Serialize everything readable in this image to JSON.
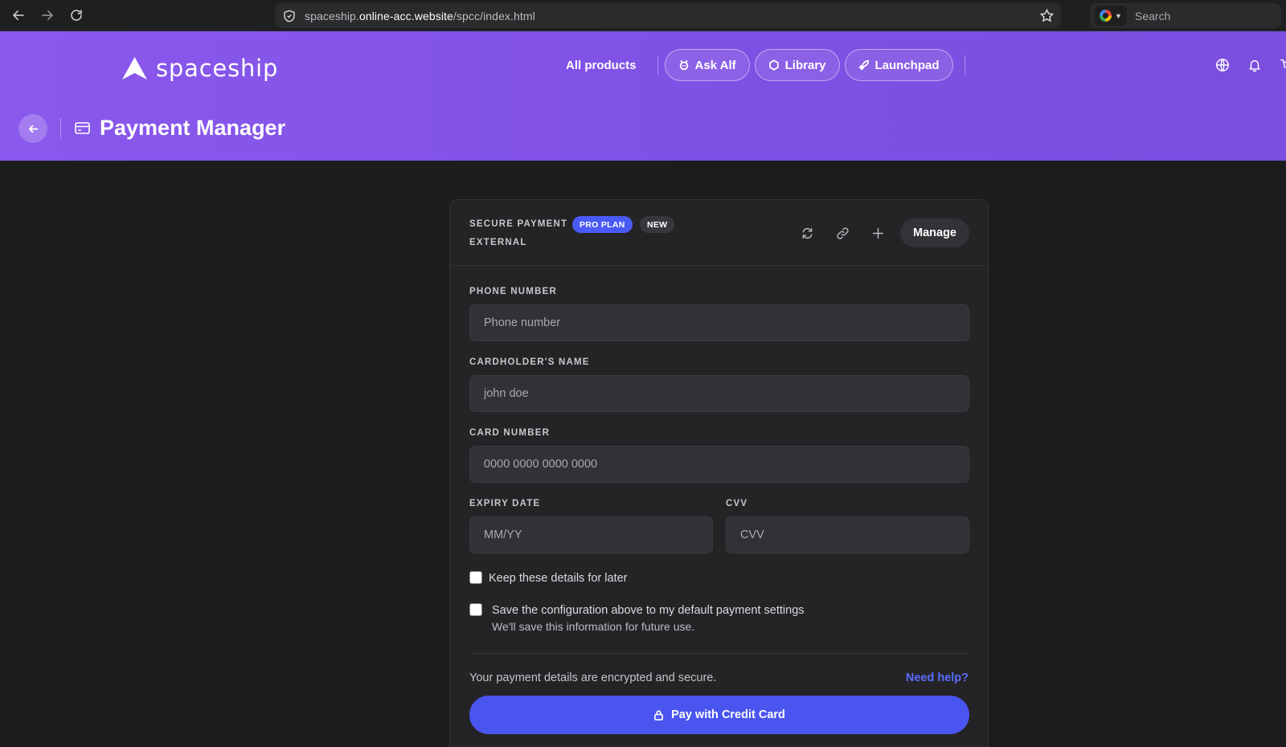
{
  "browser": {
    "url_prefix": "spaceship.",
    "url_domain": "online-acc.website",
    "url_path": "/spcc/index.html",
    "search_placeholder": "Search"
  },
  "header": {
    "brand": "spaceship",
    "nav": {
      "all_products": "All products",
      "ask_alf": "Ask Alf",
      "library": "Library",
      "launchpad": "Launchpad"
    },
    "page_title": "Payment Manager"
  },
  "card": {
    "label_secure": "SECURE PAYMENT",
    "label_external": "EXTERNAL",
    "badge_pro": "PRO PLAN",
    "badge_new": "NEW",
    "manage_label": "Manage"
  },
  "form": {
    "phone": {
      "label": "PHONE NUMBER",
      "placeholder": "Phone number",
      "value": ""
    },
    "name": {
      "label": "CARDHOLDER'S NAME",
      "placeholder": "john doe",
      "value": ""
    },
    "card_number": {
      "label": "CARD NUMBER",
      "placeholder": "0000 0000 0000 0000",
      "value": ""
    },
    "expiry": {
      "label": "EXPIRY DATE",
      "placeholder": "MM/YY",
      "value": ""
    },
    "cvv": {
      "label": "CVV",
      "placeholder": "CVV",
      "value": ""
    },
    "keep_details": {
      "label": "Keep these details for later",
      "checked": false
    },
    "save_config": {
      "label": "Save the configuration above to my default payment settings",
      "sub": "We'll save this information for future use.",
      "checked": false
    }
  },
  "footer": {
    "secure_text": "Your payment details are encrypted and secure.",
    "help_link": "Need help?",
    "pay_label": "Pay with Credit Card"
  },
  "colors": {
    "header_purple": "#8052e6",
    "accent_blue": "#4a55f0",
    "link_blue": "#5b6cff",
    "page_bg": "#1c1c1e",
    "card_bg": "#242427"
  },
  "icons": [
    "back-arrow-icon",
    "forward-arrow-icon",
    "reload-icon",
    "shield-icon",
    "star-icon",
    "google-icon",
    "spaceship-logo-icon",
    "alf-icon",
    "library-hexagon-icon",
    "rocket-icon",
    "globe-icon",
    "bell-icon",
    "cart-icon",
    "credit-card-icon",
    "refresh-icon",
    "link-icon",
    "plus-icon",
    "lock-icon"
  ]
}
